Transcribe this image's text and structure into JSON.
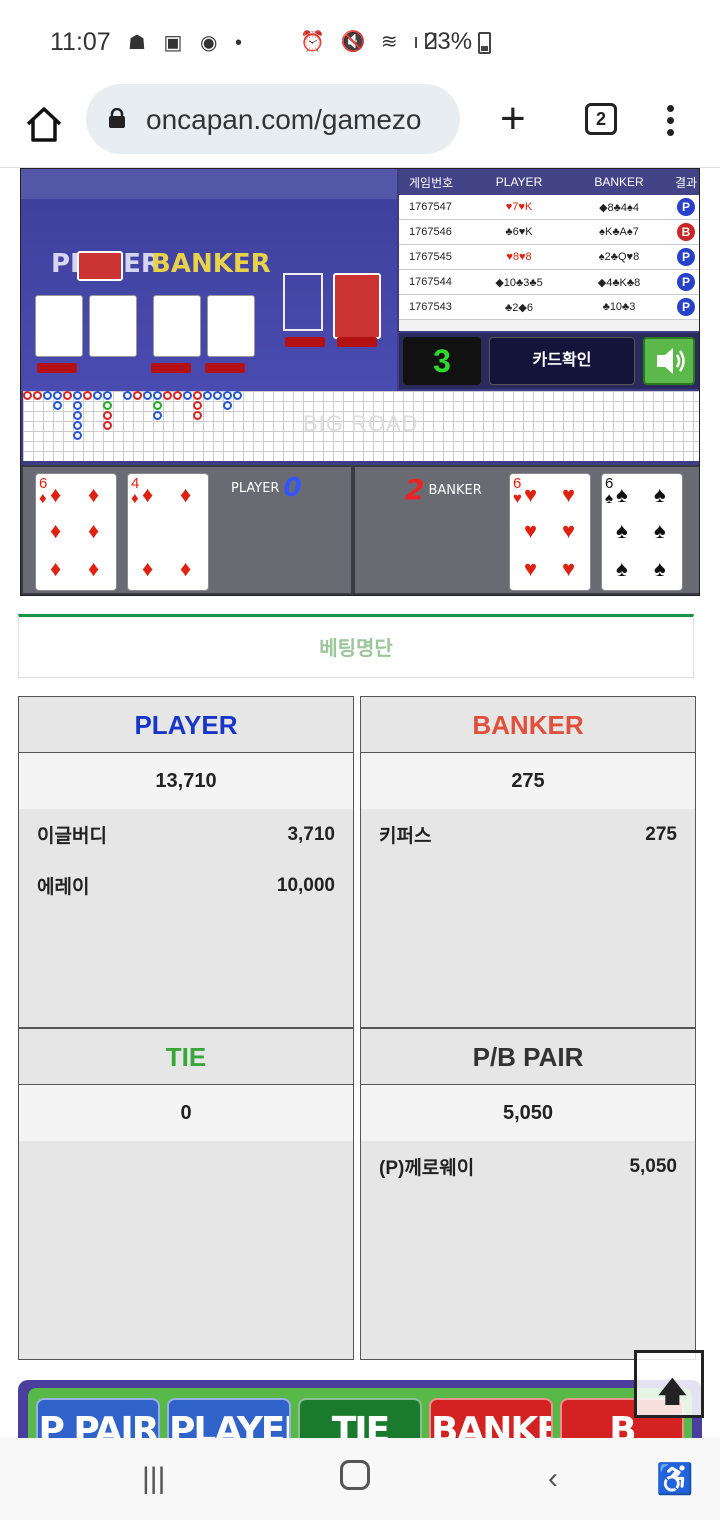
{
  "status_bar": {
    "time": "11:07",
    "battery": "23%"
  },
  "browser": {
    "url": "oncapan.com/gamezo",
    "tab_count": "2"
  },
  "game": {
    "felt": {
      "player_label": "PLAYER",
      "banker_label": "BANKER"
    },
    "history": {
      "headers": [
        "게임번호",
        "PLAYER",
        "BANKER",
        "결과"
      ],
      "rows": [
        {
          "no": "1767547",
          "player": "♥7♥K",
          "banker": "◆8♣4♠4",
          "result": "P"
        },
        {
          "no": "1767546",
          "player": "♣6♥K",
          "banker": "♠K♣A♠7",
          "result": "B"
        },
        {
          "no": "1767545",
          "player": "♥8♥8",
          "banker": "♠2♣Q♥8",
          "result": "P"
        },
        {
          "no": "1767544",
          "player": "◆10♣3♣5",
          "banker": "◆4♣K♣8",
          "result": "P"
        },
        {
          "no": "1767543",
          "player": "♣2◆6",
          "banker": "♣10♣3",
          "result": "P"
        }
      ]
    },
    "counter": "3",
    "card_check_label": "카드확인",
    "big_road_label": "BIG ROAD",
    "player_text": "PLAYER",
    "player_score": "0",
    "banker_text": "BANKER",
    "banker_score": "2",
    "player_cards": [
      {
        "rank": "6",
        "suit": "♦",
        "color": "#d21"
      },
      {
        "rank": "4",
        "suit": "♦",
        "color": "#d21"
      }
    ],
    "banker_cards": [
      {
        "rank": "6",
        "suit": "♥",
        "color": "#d21"
      },
      {
        "rank": "6",
        "suit": "♠",
        "color": "#111"
      }
    ]
  },
  "betting_list_title": "베팅명단",
  "panels": {
    "player": {
      "title": "PLAYER",
      "color": "#1736c9",
      "total": "13,710",
      "items": [
        {
          "name": "이글버디",
          "amount": "3,710"
        },
        {
          "name": "에레이",
          "amount": "10,000"
        }
      ]
    },
    "banker": {
      "title": "BANKER",
      "color": "#e0503a",
      "total": "275",
      "items": [
        {
          "name": "키퍼스",
          "amount": "275"
        }
      ]
    },
    "tie": {
      "title": "TIE",
      "color": "#3aa63a",
      "total": "0",
      "items": []
    },
    "pair": {
      "title": "P/B PAIR",
      "color": "#333333",
      "total": "5,050",
      "items": [
        {
          "name": "(P)께로웨이",
          "amount": "5,050"
        }
      ]
    }
  },
  "bet_buttons": [
    {
      "label": "P PAIR",
      "color": "#2f63c9"
    },
    {
      "label": "PLAYER",
      "color": "#2f63c9"
    },
    {
      "label": "TIE",
      "color": "#1a7a2e"
    },
    {
      "label": "BANKER",
      "color": "#d42222"
    },
    {
      "label": "B PAIR",
      "color": "#d42222"
    }
  ]
}
